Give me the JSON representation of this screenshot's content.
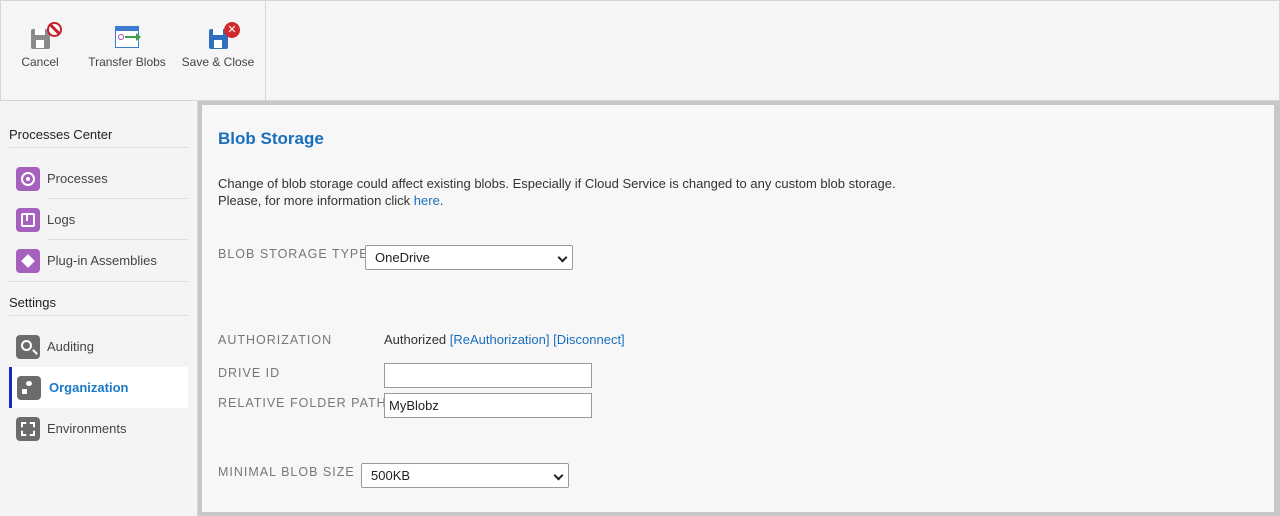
{
  "toolbar": {
    "cancel_label": "Cancel",
    "transfer_label": "Transfer Blobs",
    "save_close_label": "Save & Close"
  },
  "sidebar": {
    "section_processes": "Processes Center",
    "section_settings": "Settings",
    "items": [
      {
        "label": "Processes",
        "icon": "processes-icon"
      },
      {
        "label": "Logs",
        "icon": "logs-icon"
      },
      {
        "label": "Plug-in Assemblies",
        "icon": "plugin-assemblies-icon"
      },
      {
        "label": "Auditing",
        "icon": "auditing-icon"
      },
      {
        "label": "Organization",
        "icon": "organization-icon",
        "active": true
      },
      {
        "label": "Environments",
        "icon": "environments-icon"
      }
    ]
  },
  "main": {
    "title": "Blob Storage",
    "desc_line1": "Change of blob storage could affect existing blobs. Especially if Cloud Service is changed to any custom blob storage.",
    "desc_line2_prefix": "Please, for more information click ",
    "desc_link": "here",
    "desc_line2_suffix": ".",
    "blob_storage_type_label": "Blob Storage Type",
    "blob_storage_type_value": "OneDrive",
    "authorization_label": "Authorization",
    "authorization_status": "Authorized",
    "reauthorization_link": "[ReAuthorization]",
    "disconnect_link": "[Disconnect]",
    "drive_id_label": "Drive ID",
    "drive_id_value": "",
    "relative_folder_path_label": "Relative Folder Path",
    "relative_folder_path_value": "MyBlobz",
    "minimal_blob_size_label": "Minimal Blob Size",
    "minimal_blob_size_value": "500KB"
  },
  "colors": {
    "accent": "#1a6fbd",
    "active_indicator": "#1b2bbd",
    "nav_icon_purple": "#a561bd",
    "nav_icon_dark": "#6c6c6c"
  }
}
